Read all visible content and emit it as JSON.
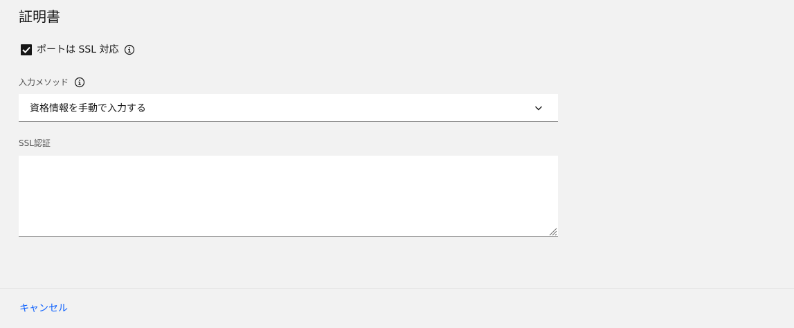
{
  "section": {
    "title": "証明書"
  },
  "ssl_checkbox": {
    "label": "ポートは SSL 対応",
    "checked": true
  },
  "input_method": {
    "label": "入力メソッド",
    "selected": "資格情報を手動で入力する"
  },
  "ssl_cert": {
    "label": "SSL認証",
    "value": ""
  },
  "footer": {
    "cancel_label": "キャンセル"
  },
  "colors": {
    "background": "#f2f2f2",
    "field_background": "#ffffff",
    "link": "#0f62fe",
    "text": "#161616",
    "label": "#525252"
  }
}
